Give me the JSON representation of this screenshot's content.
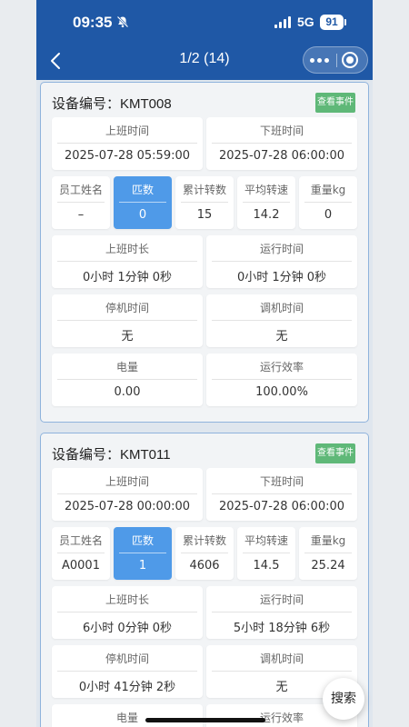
{
  "status_bar": {
    "time": "09:35",
    "network": "5G",
    "battery": "91"
  },
  "navbar": {
    "title": "1/2 (14)"
  },
  "cards": [
    {
      "device_label": "设备编号：KMT008",
      "event_button": "查看事件",
      "start_time": {
        "label": "上班时间",
        "value": "2025-07-28 05:59:00"
      },
      "end_time": {
        "label": "下班时间",
        "value": "2025-07-28 06:00:00"
      },
      "employee": {
        "label": "员工姓名",
        "value": "–"
      },
      "pieces": {
        "label": "匹数",
        "value": "0"
      },
      "total_rev": {
        "label": "累计转数",
        "value": "15"
      },
      "avg_speed": {
        "label": "平均转速",
        "value": "14.2"
      },
      "weight": {
        "label": "重量kg",
        "value": "0"
      },
      "shift_duration": {
        "label": "上班时长",
        "value": "0小时 1分钟 0秒"
      },
      "run_time": {
        "label": "运行时间",
        "value": "0小时 1分钟 0秒"
      },
      "stop_time": {
        "label": "停机时间",
        "value": "无"
      },
      "tune_time": {
        "label": "调机时间",
        "value": "无"
      },
      "power": {
        "label": "电量",
        "value": "0.00"
      },
      "efficiency": {
        "label": "运行效率",
        "value": "100.00%"
      }
    },
    {
      "device_label": "设备编号：KMT011",
      "event_button": "查看事件",
      "start_time": {
        "label": "上班时间",
        "value": "2025-07-28 00:00:00"
      },
      "end_time": {
        "label": "下班时间",
        "value": "2025-07-28 06:00:00"
      },
      "employee": {
        "label": "员工姓名",
        "value": "A0001"
      },
      "pieces": {
        "label": "匹数",
        "value": "1"
      },
      "total_rev": {
        "label": "累计转数",
        "value": "4606"
      },
      "avg_speed": {
        "label": "平均转速",
        "value": "14.5"
      },
      "weight": {
        "label": "重量kg",
        "value": "25.24"
      },
      "shift_duration": {
        "label": "上班时长",
        "value": "6小时 0分钟 0秒"
      },
      "run_time": {
        "label": "运行时间",
        "value": "5小时 18分钟 6秒"
      },
      "stop_time": {
        "label": "停机时间",
        "value": "0小时 41分钟 2秒"
      },
      "tune_time": {
        "label": "调机时间",
        "value": "无"
      },
      "power": {
        "label": "电量"
      },
      "efficiency": {
        "label": "运行效率"
      }
    }
  ],
  "search_button": "搜索",
  "colors": {
    "header": "#1f58a6",
    "highlight": "#4f9ae8",
    "event_button": "#5fb878"
  }
}
